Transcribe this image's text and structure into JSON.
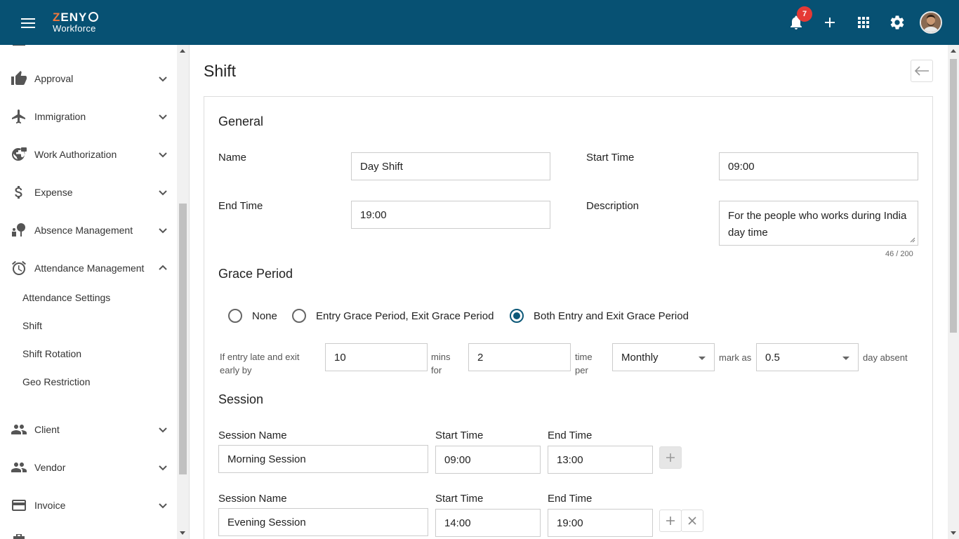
{
  "app": {
    "brand_top": "ZENY",
    "brand_bottom": "Workforce",
    "notification_count": "7",
    "accent_color": "#075173",
    "brand_accent": "#f0783c"
  },
  "header_icons": [
    "menu-icon",
    "bell-icon",
    "plus-icon",
    "apps-grid-icon",
    "gear-icon",
    "avatar"
  ],
  "sidebar": {
    "items": [
      {
        "label": "Approval",
        "icon": "thumbs-up-icon"
      },
      {
        "label": "Immigration",
        "icon": "airplane-icon"
      },
      {
        "label": "Work Authorization",
        "icon": "globe-lock-icon"
      },
      {
        "label": "Expense",
        "icon": "dollar-icon"
      },
      {
        "label": "Absence Management",
        "icon": "person-tree-icon"
      },
      {
        "label": "Attendance Management",
        "icon": "alarm-clock-icon"
      }
    ],
    "sub_items": [
      "Attendance Settings",
      "Shift",
      "Shift Rotation",
      "Geo Restriction"
    ],
    "items_after": [
      {
        "label": "Client",
        "icon": "people-icon"
      },
      {
        "label": "Vendor",
        "icon": "people-icon"
      },
      {
        "label": "Invoice",
        "icon": "credit-card-icon"
      }
    ]
  },
  "page": {
    "title": "Shift",
    "general": {
      "title": "General",
      "name_label": "Name",
      "name_value": "Day Shift",
      "start_label": "Start Time",
      "start_value": "09:00",
      "end_label": "End Time",
      "end_value": "19:00",
      "desc_label": "Description",
      "desc_value": "For the people who works during India day time",
      "desc_counter": "46 / 200"
    },
    "grace": {
      "title": "Grace Period",
      "options": [
        "None",
        "Entry Grace Period, Exit Grace Period",
        "Both Entry and Exit Grace Period"
      ],
      "selected": "Both Entry and Exit Grace Period",
      "rule_text": "If entry late and exit early by",
      "mins_value": "10",
      "mins_label": "mins for",
      "times_value": "2",
      "times_label": "time per",
      "period_value": "Monthly",
      "mark_label": "mark as",
      "absent_value": "0.5",
      "absent_label": "day absent"
    },
    "session": {
      "title": "Session",
      "name_label": "Session Name",
      "start_label": "Start Time",
      "end_label": "End Time",
      "rows": [
        {
          "name": "Morning Session",
          "start": "09:00",
          "end": "13:00"
        },
        {
          "name": "Evening Session",
          "start": "14:00",
          "end": "19:00"
        }
      ]
    }
  }
}
